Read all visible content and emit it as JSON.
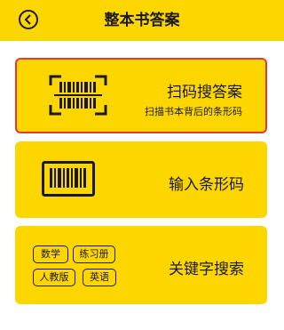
{
  "header": {
    "title": "整本书答案",
    "back_icon": "back-circle-icon"
  },
  "cards": [
    {
      "title": "扫码搜答案",
      "subtitle": "扫描书本背后的条形码",
      "icon": "barcode-scan-icon",
      "selected": true
    },
    {
      "title": "输入条形码",
      "icon": "barcode-icon"
    },
    {
      "title": "关键字搜索",
      "tags": [
        "数学",
        "练习册",
        "人教版",
        "英语"
      ]
    }
  ],
  "colors": {
    "accent": "#fdd600",
    "selected_border": "#e53935",
    "text": "#1a1a1a"
  }
}
